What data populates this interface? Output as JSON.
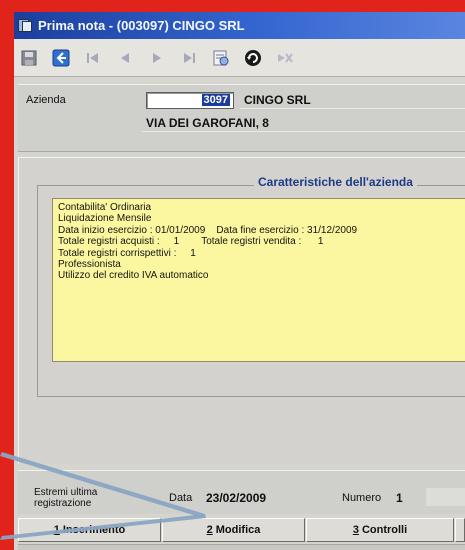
{
  "window": {
    "title": "Prima nota  -  (003097) CINGO SRL"
  },
  "toolbar": {
    "buttons": [
      {
        "name": "save-button",
        "icon": "floppy-disk-icon"
      },
      {
        "name": "back-button",
        "icon": "arrow-left-icon"
      },
      {
        "name": "first-record-button",
        "icon": "first-icon"
      },
      {
        "name": "prev-record-button",
        "icon": "prev-icon"
      },
      {
        "name": "next-record-button",
        "icon": "next-icon"
      },
      {
        "name": "last-record-button",
        "icon": "last-icon"
      },
      {
        "name": "print-preview-button",
        "icon": "print-preview-icon"
      },
      {
        "name": "refresh-button",
        "icon": "refresh-icon"
      },
      {
        "name": "delete-button",
        "icon": "delete-icon"
      }
    ]
  },
  "azienda": {
    "label": "Azienda",
    "code": "3097",
    "name": "CINGO SRL",
    "address": "VIA DEI GAROFANI, 8"
  },
  "caratteristiche": {
    "title": "Caratteristiche dell'azienda",
    "lines": [
      "Contabilita' Ordinaria",
      "Liquidazione Mensile",
      "Data inizio esercizio : 01/01/2009    Data fine esercizio : 31/12/2009",
      "Totale registri acquisti :     1        Totale registri vendita :      1",
      "Totale registri corrispettivi :     1",
      "Professionista",
      "Utilizzo del credito IVA automatico"
    ]
  },
  "extremi": {
    "label": "Estremi ultima registrazione",
    "data_label": "Data",
    "data_value": "23/02/2009",
    "numero_label": "Numero",
    "numero_value": "1"
  },
  "buttons": [
    {
      "key": "1",
      "label": "Inserimento"
    },
    {
      "key": "2",
      "label": "Modifica"
    },
    {
      "key": "3",
      "label": "Controlli"
    }
  ],
  "colors": {
    "titlebar": "#2a55bf",
    "note_background": "#fbf7a0",
    "frame_red": "#e0241c",
    "group_title": "#1e3b86"
  }
}
